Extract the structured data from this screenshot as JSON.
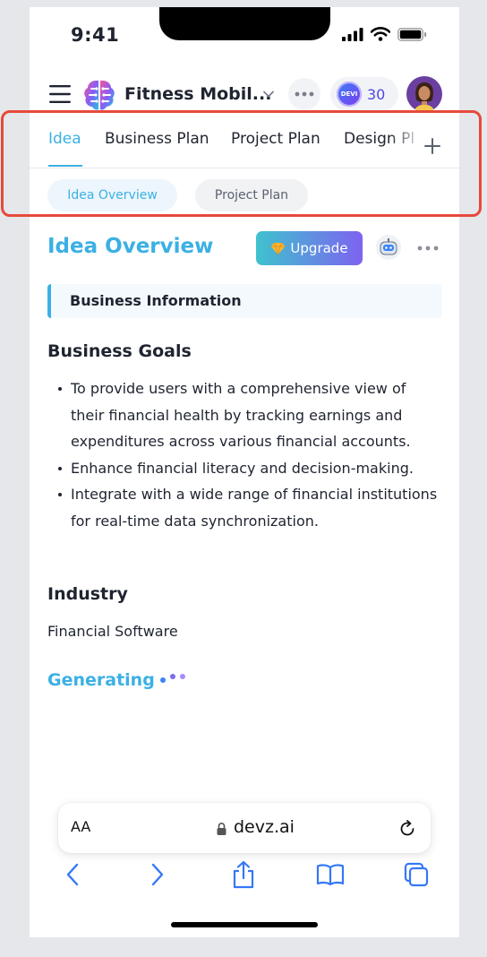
{
  "status_bar": {
    "time": "9:41"
  },
  "header": {
    "app_title": "Fitness Mobil...",
    "credits_badge": "DEVI",
    "credits_count": "30"
  },
  "tabs": [
    {
      "label": "Idea",
      "active": true
    },
    {
      "label": "Business Plan",
      "active": false
    },
    {
      "label": "Project Plan",
      "active": false
    },
    {
      "label": "Design Pl",
      "active": false
    }
  ],
  "subtabs": [
    {
      "label": "Idea Overview",
      "active": true
    },
    {
      "label": "Project Plan",
      "active": false
    }
  ],
  "content": {
    "title": "Idea Overview",
    "upgrade_label": "Upgrade",
    "section_label": "Business Information",
    "goals_heading": "Business Goals",
    "goals": [
      "To provide users with a comprehensive view of their financial health by tracking earnings and expenditures across various financial accounts.",
      "Enhance financial literacy and decision-making.",
      "Integrate with a wide range of financial institutions for real-time data synchronization."
    ],
    "industry_heading": "Industry",
    "industry_value": "Financial Software",
    "generating_label": "Generating"
  },
  "browser": {
    "text_size_label": "AA",
    "url": "devz.ai"
  },
  "colors": {
    "accent": "#3bb0e4",
    "highlight_box": "#e64a3b",
    "credits": "#4f46e5",
    "upgrade_start": "#3fc2cf",
    "upgrade_end": "#7d63f0",
    "safari_blue": "#3478f6"
  },
  "icons": {
    "menu": "hamburger-menu-icon",
    "logo": "brain-logo-icon",
    "chevron": "chevron-down-icon",
    "more": "more-horizontal-icon",
    "add_tab": "plus-icon",
    "upgrade": "diamond-icon",
    "bot": "robot-icon",
    "lock": "lock-icon",
    "reload": "reload-icon",
    "back": "back-arrow-icon",
    "forward": "forward-arrow-icon",
    "share": "share-icon",
    "bookmarks": "bookmarks-icon",
    "tabs": "tabs-icon"
  }
}
